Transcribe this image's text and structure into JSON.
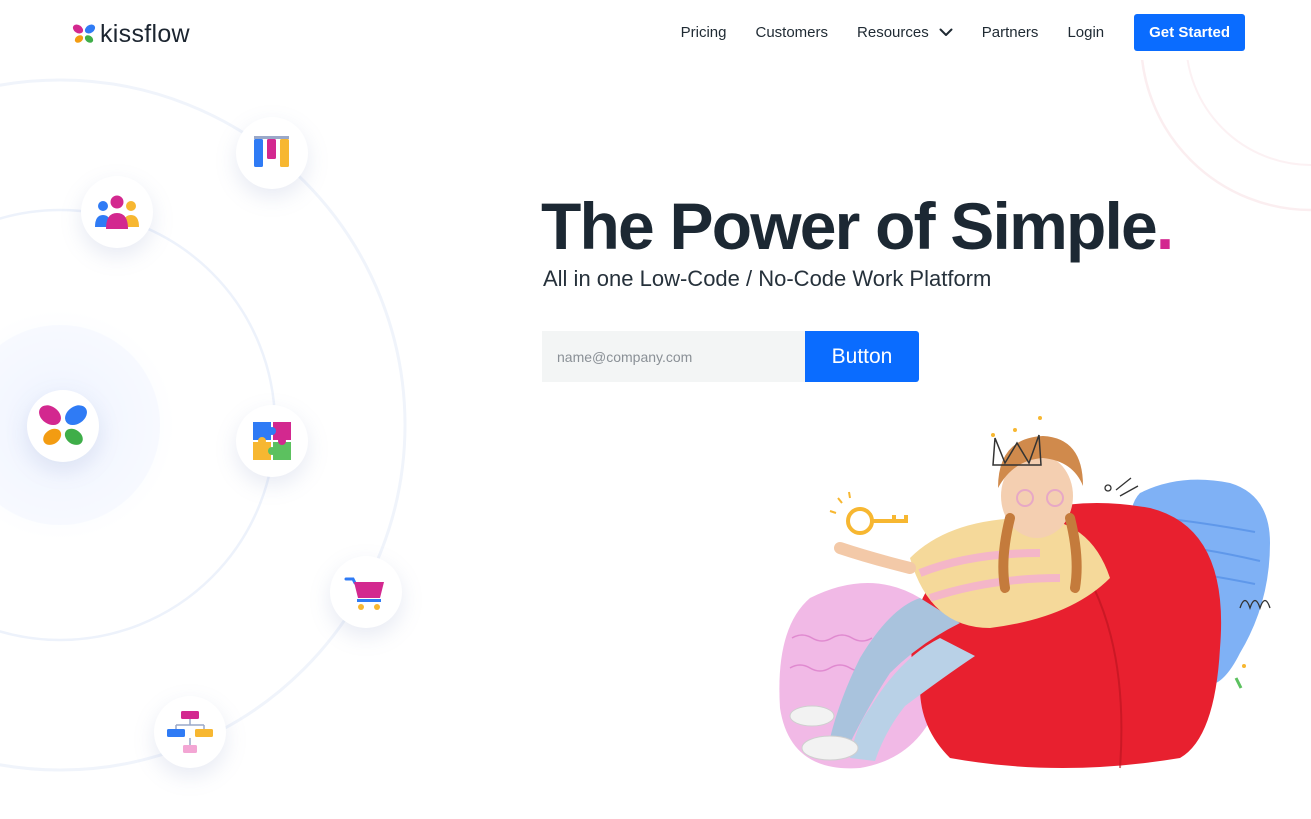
{
  "brand": {
    "name": "kissflow"
  },
  "nav": {
    "items": [
      "Pricing",
      "Customers",
      "Resources",
      "Partners",
      "Login"
    ],
    "cta": "Get Started"
  },
  "hero": {
    "headline": "The Power of Simple",
    "headline_dot": ".",
    "subline": "All in one Low-Code / No-Code Work Platform",
    "email_placeholder": "name@company.com",
    "button": "Button"
  },
  "colors": {
    "primary": "#0a6cff",
    "accent_dot": "#d3288f",
    "heading": "#1c2833"
  },
  "orbit_icons": [
    "boards-icon",
    "people-icon",
    "kissflow-logo-icon",
    "puzzle-icon",
    "cart-icon",
    "flowchart-icon"
  ]
}
